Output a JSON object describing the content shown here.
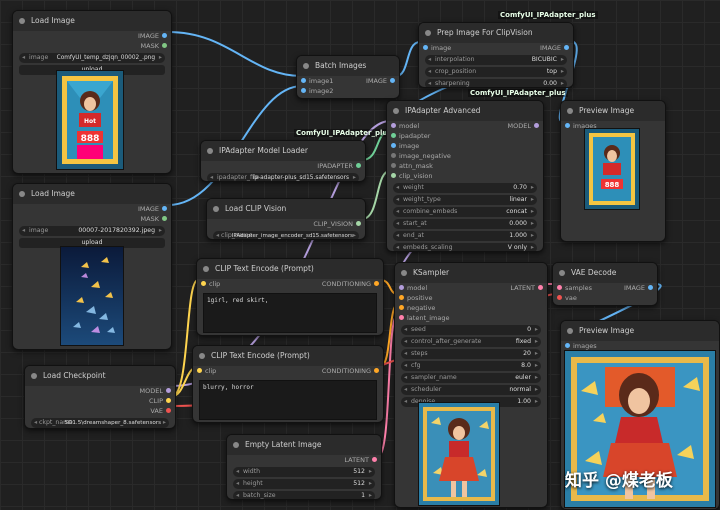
{
  "nodes": {
    "load_image_1": {
      "title": "Load Image",
      "outputs": [
        "IMAGE",
        "MASK"
      ],
      "image_label": "image",
      "image_value": "ComfyUI_temp_dzjqn_00002_.png",
      "upload": "upload"
    },
    "load_image_2": {
      "title": "Load Image",
      "outputs": [
        "IMAGE",
        "MASK"
      ],
      "image_label": "image",
      "image_value": "00007-2017820392.jpeg",
      "upload": "upload"
    },
    "batch_images": {
      "title": "Batch Images",
      "inputs": [
        "image1",
        "image2"
      ],
      "output": "IMAGE"
    },
    "prep_image": {
      "title": "Prep Image For ClipVision",
      "tag": "ComfyUI_IPAdapter_plus",
      "input": "image",
      "output": "IMAGE",
      "widgets": [
        {
          "label": "interpolation",
          "value": "BICUBIC"
        },
        {
          "label": "crop_position",
          "value": "top"
        },
        {
          "label": "sharpening",
          "value": "0.00"
        }
      ]
    },
    "ipadapter_loader": {
      "title": "IPAdapter Model Loader",
      "tag": "ComfyUI_IPAdapter_plus",
      "output": "IPADAPTER",
      "widget_label": "ipadapter_file",
      "widget_value": "ip-adapter-plus_sd15.safetensors"
    },
    "load_clip_vision": {
      "title": "Load CLIP Vision",
      "output": "CLIP_VISION",
      "widget_label": "clip_name",
      "widget_value": "IPAdapter_image_encoder_sd15.safetensors"
    },
    "ipadapter_advanced": {
      "title": "IPAdapter Advanced",
      "tag": "ComfyUI_IPAdapter_plus",
      "inputs": [
        "model",
        "ipadapter",
        "image",
        "image_negative",
        "attn_mask",
        "clip_vision"
      ],
      "output": "MODEL",
      "widgets": [
        {
          "label": "weight",
          "value": "0.70"
        },
        {
          "label": "weight_type",
          "value": "linear"
        },
        {
          "label": "combine_embeds",
          "value": "concat"
        },
        {
          "label": "start_at",
          "value": "0.000"
        },
        {
          "label": "end_at",
          "value": "1.000"
        },
        {
          "label": "embeds_scaling",
          "value": "V only"
        }
      ]
    },
    "preview_1": {
      "title": "Preview Image",
      "input": "images"
    },
    "clip_text_pos": {
      "title": "CLIP Text Encode (Prompt)",
      "input": "clip",
      "output": "CONDITIONING",
      "text": "1girl, red skirt,"
    },
    "clip_text_neg": {
      "title": "CLIP Text Encode (Prompt)",
      "input": "clip",
      "output": "CONDITIONING",
      "text": "blurry, horror"
    },
    "load_checkpoint": {
      "title": "Load Checkpoint",
      "outputs": [
        "MODEL",
        "CLIP",
        "VAE"
      ],
      "widget_label": "ckpt_name",
      "widget_value": "SD1.5\\dreamshaper_8.safetensors"
    },
    "empty_latent": {
      "title": "Empty Latent Image",
      "output": "LATENT",
      "widgets": [
        {
          "label": "width",
          "value": "512"
        },
        {
          "label": "height",
          "value": "512"
        },
        {
          "label": "batch_size",
          "value": "1"
        }
      ]
    },
    "ksampler": {
      "title": "KSampler",
      "inputs": [
        "model",
        "positive",
        "negative",
        "latent_image"
      ],
      "output": "LATENT",
      "widgets": [
        {
          "label": "seed",
          "value": "0"
        },
        {
          "label": "control_after_generate",
          "value": "fixed"
        },
        {
          "label": "steps",
          "value": "20"
        },
        {
          "label": "cfg",
          "value": "8.0"
        },
        {
          "label": "sampler_name",
          "value": "euler"
        },
        {
          "label": "scheduler",
          "value": "normal"
        },
        {
          "label": "denoise",
          "value": "1.00"
        }
      ]
    },
    "vae_decode": {
      "title": "VAE Decode",
      "inputs": [
        "samples",
        "vae"
      ],
      "output": "IMAGE"
    },
    "preview_2": {
      "title": "Preview Image",
      "input": "images"
    }
  },
  "watermark": "知乎 @煤老板",
  "colors": {
    "IMAGE": "#64b5f6",
    "MASK": "#81c784",
    "CLIP": "#ffd54f",
    "MODEL": "#b39ddb",
    "CONDITIONING": "#ffa726",
    "LATENT": "#ff80ab",
    "VAE": "#ef5350",
    "IPADAPTER": "#6fcf97",
    "CLIP_VISION": "#a5d6a7"
  }
}
